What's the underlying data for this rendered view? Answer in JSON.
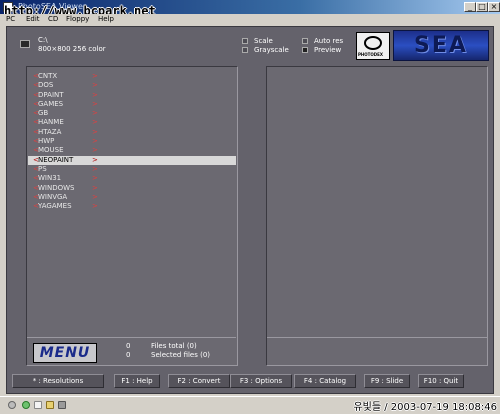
{
  "window": {
    "title": "PhotoSEA Viewer",
    "controls": {
      "minimize": "_",
      "maximize": "□",
      "close": "×"
    },
    "watermark": "http://www.bcpark.net"
  },
  "menubar": [
    "PC",
    "Edit",
    "CD",
    "Floppy",
    "Help"
  ],
  "info": {
    "path": "C:\\",
    "resolution": "800×800  256 color"
  },
  "options": {
    "scale": {
      "label": "Scale",
      "checked": false
    },
    "grayscale": {
      "label": "Grayscale",
      "checked": false
    },
    "auto_res": {
      "label": "Auto res",
      "checked": false
    },
    "preview": {
      "label": "Preview",
      "checked": true
    }
  },
  "logos": {
    "photo": "PHOTODEX",
    "sea": "SEA"
  },
  "directories": [
    "CNTX",
    "DOS",
    "DPAINT",
    "GAMES",
    "GB",
    "HANME",
    "HTAZA",
    "HWP",
    "MOUSE",
    "NEOPAINT",
    "PS",
    "WIN31",
    "WINDOWS",
    "WINVGA",
    "YAGAMES"
  ],
  "selected_directory": "NEOPAINT",
  "menu_button": "MENU",
  "counts": {
    "files_total_value": "0",
    "files_total_label": "Files total (0)",
    "selected_value": "0",
    "selected_label": "Selected files (0)"
  },
  "function_keys": [
    "* : Resolutions",
    "F1 : Help",
    "F2 : Convert",
    "F3 : Options",
    "F4 : Catalog",
    "F9 : Slide",
    "F10 : Quit"
  ],
  "stamp": "유빛들 / 2003-07-19 18:08:46",
  "colors": {
    "selection_bg": "#d8d8d8",
    "bracket": "#e04040",
    "panel": "#6b6971"
  }
}
